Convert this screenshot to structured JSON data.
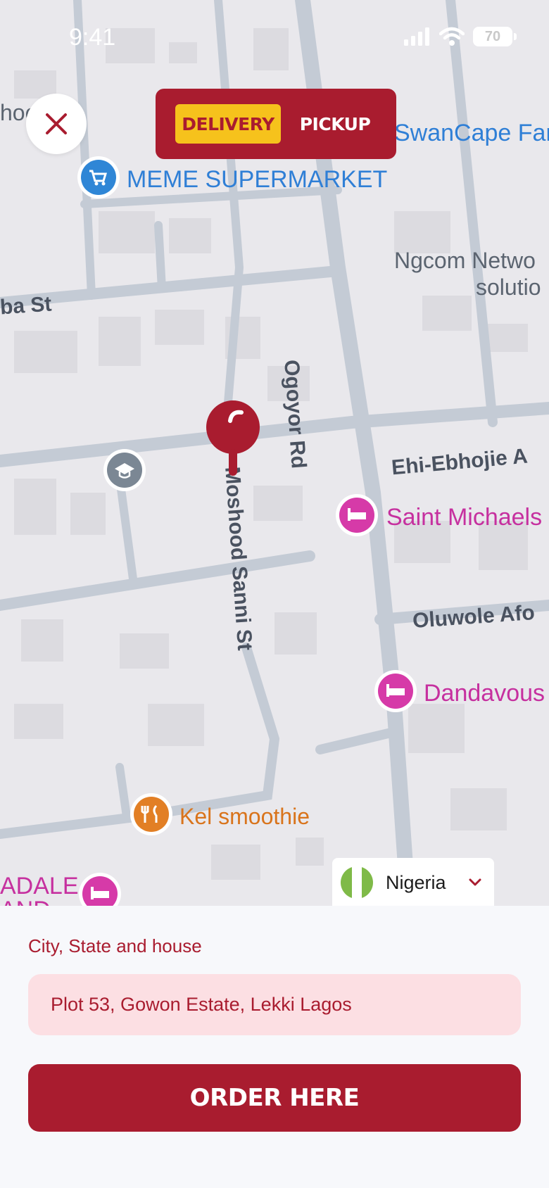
{
  "status_bar": {
    "time": "9:41",
    "battery": "70"
  },
  "mode_toggle": {
    "delivery_label": "DELIVERY",
    "pickup_label": "PICKUP",
    "active": "DELIVERY"
  },
  "map": {
    "pois": {
      "supermarket": "MEME SUPERMARKET",
      "swancape": "SwanCape Far",
      "ngcom_line1": "Ngcom Netwo",
      "ngcom_line2": "solutio",
      "saint_michaels": "Saint Michaels",
      "dandavous": "Dandavous",
      "kel_smoothie": "Kel smoothie",
      "adale_line1": "ADALE",
      "adale_line2": "AND",
      "hoc": "hoc"
    },
    "streets": {
      "ba_st": "ba St",
      "ogoyor_rd": "Ogoyor Rd",
      "ehi_ebhojie": "Ehi-Ebhojie A",
      "oluwole": "Oluwole Afo",
      "moshood_sanni": "Moshood Sanni St"
    }
  },
  "country_select": {
    "value": "Nigeria"
  },
  "address": {
    "label": "City, State and house",
    "value": "Plot 53, Gowon Estate, Lekki Lagos"
  },
  "order_button": {
    "label": "ORDER HERE"
  },
  "colors": {
    "brand": "#a91c2f",
    "accent": "#f6c21c",
    "input_bg": "#fcdfe3"
  }
}
